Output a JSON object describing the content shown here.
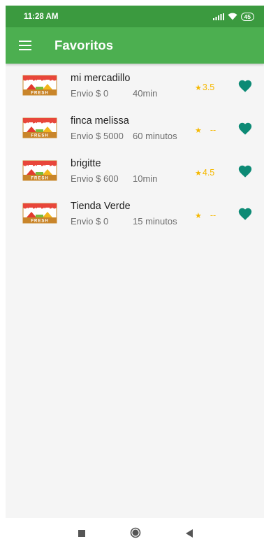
{
  "status_bar": {
    "time": "11:28 AM",
    "battery": "45"
  },
  "app_bar": {
    "title": "Favoritos",
    "menu_icon": "menu-icon"
  },
  "colors": {
    "status_bar": "#3b9a3f",
    "app_bar": "#4caf50",
    "rating": "#f5b800",
    "heart": "#0d8a75",
    "background": "#f5f5f5"
  },
  "favorites": [
    {
      "name": "mi mercadillo",
      "envio": "Envio $ 0",
      "time": "40min",
      "star": "★",
      "rating": "3.5"
    },
    {
      "name": "finca melissa",
      "envio": "Envio $ 5000",
      "time": "60 minutos",
      "star": "★",
      "rating": "--"
    },
    {
      "name": "brigitte",
      "envio": "Envio $ 600",
      "time": "10min",
      "star": "★",
      "rating": "4.5"
    },
    {
      "name": "Tienda Verde",
      "envio": "Envio $ 0",
      "time": "15 minutos",
      "star": "★",
      "rating": "--"
    }
  ],
  "logo_text": "FRESH"
}
